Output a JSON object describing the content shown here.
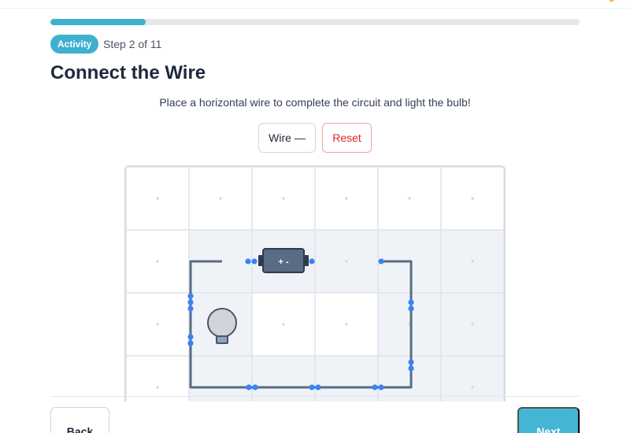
{
  "progress": {
    "current_step": 2,
    "total_steps": 11,
    "fraction": 0.18,
    "color": "#3fb0cf"
  },
  "header": {
    "badge": "Activity",
    "step_text": "Step 2 of 11",
    "title": "Connect the Wire"
  },
  "instruction": "Place a horizontal wire to complete the circuit and light the bulb!",
  "toolbar": {
    "wire_label": "Wire —",
    "reset_label": "Reset"
  },
  "board": {
    "columns": 6,
    "visible_rows": 4,
    "highlighted_cells": [
      [
        1,
        1
      ],
      [
        2,
        1
      ],
      [
        3,
        1
      ],
      [
        4,
        1
      ],
      [
        5,
        1
      ],
      [
        1,
        2
      ],
      [
        4,
        2
      ],
      [
        5,
        2
      ],
      [
        1,
        3
      ],
      [
        2,
        3
      ],
      [
        3,
        3
      ],
      [
        4,
        3
      ],
      [
        5,
        3
      ]
    ],
    "components": [
      {
        "type": "battery",
        "icon": "battery-icon",
        "glyph": "+ -"
      },
      {
        "type": "bulb",
        "icon": "bulb-icon",
        "lit": false
      }
    ],
    "colors": {
      "wire": "#5a6b85",
      "node": "#3b82f6",
      "highlight": "#eff3f8",
      "grid": "#e1e5ea"
    }
  },
  "footer": {
    "back_label": "Back",
    "next_label": "Next"
  }
}
